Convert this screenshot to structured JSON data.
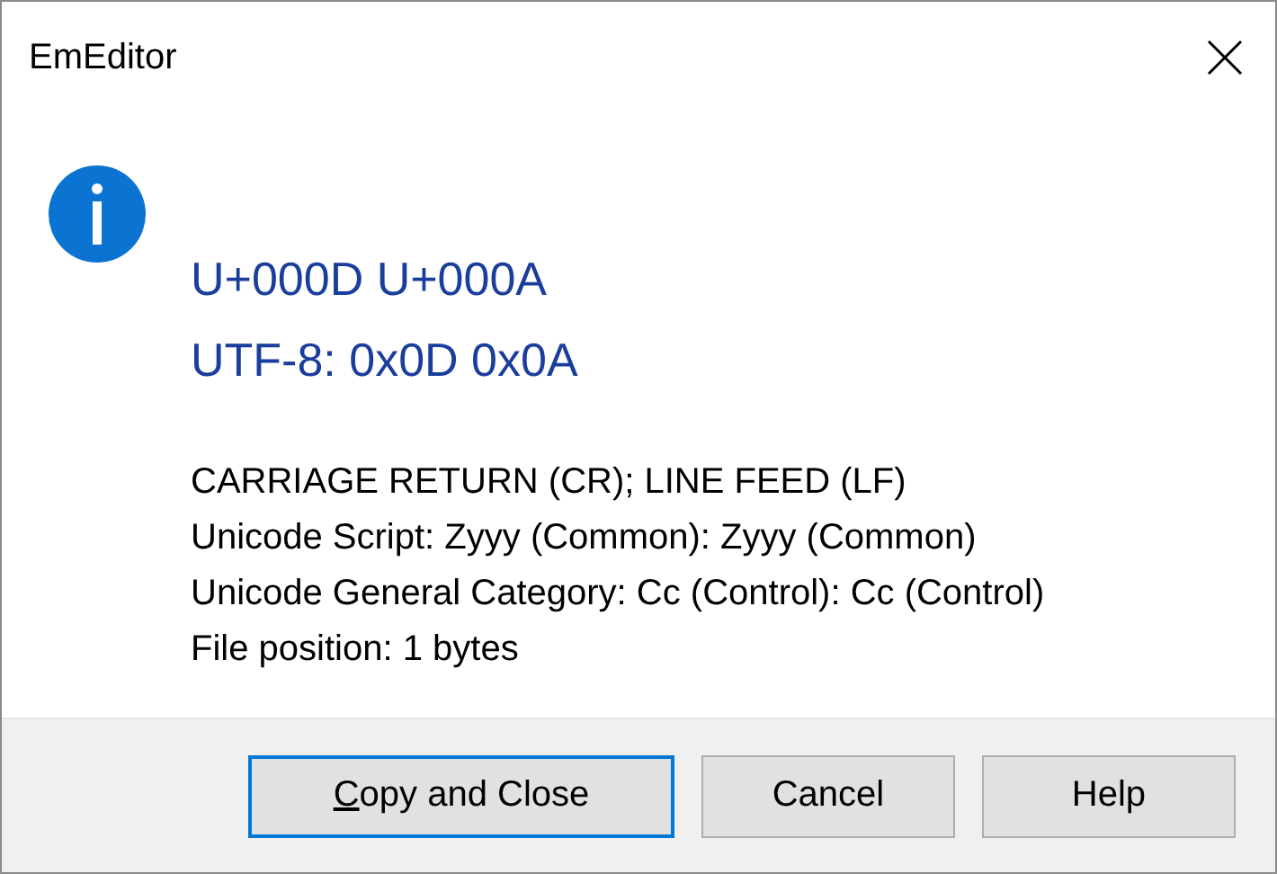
{
  "window": {
    "title": "EmEditor"
  },
  "message": {
    "headings": [
      "U+000D U+000A",
      "UTF-8: 0x0D 0x0A"
    ],
    "details": [
      "CARRIAGE RETURN (CR); LINE FEED (LF)",
      "Unicode Script: Zyyy (Common): Zyyy (Common)",
      "Unicode General Category: Cc (Control): Cc (Control)",
      "File position: 1 bytes"
    ]
  },
  "buttons": [
    {
      "label": "Copy and Close",
      "default": true,
      "mnemonic_underlined": true
    },
    {
      "label": "Cancel",
      "default": false,
      "mnemonic_underlined": false
    },
    {
      "label": "Help",
      "default": false,
      "mnemonic_underlined": false
    }
  ]
}
